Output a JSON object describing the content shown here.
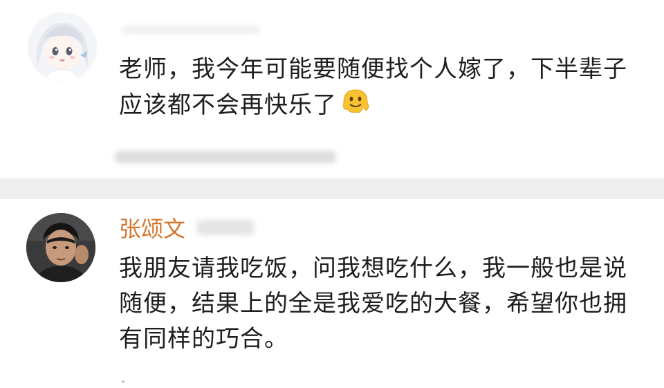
{
  "comments": [
    {
      "text": "老师，我今年可能要随便找个人嫁了，下半辈子应该都不会再快乐了",
      "emoji": "melting-face-emoji"
    },
    {
      "username": "张颂文",
      "text": "我朋友请我吃饭，问我想吃什么，我一般也是说随便，结果上的全是我爱吃的大餐，希望你也拥有同样的巧合。"
    }
  ],
  "colors": {
    "username": "#d5752c",
    "divider": "#eeeeee",
    "text": "#1e1e1e"
  }
}
